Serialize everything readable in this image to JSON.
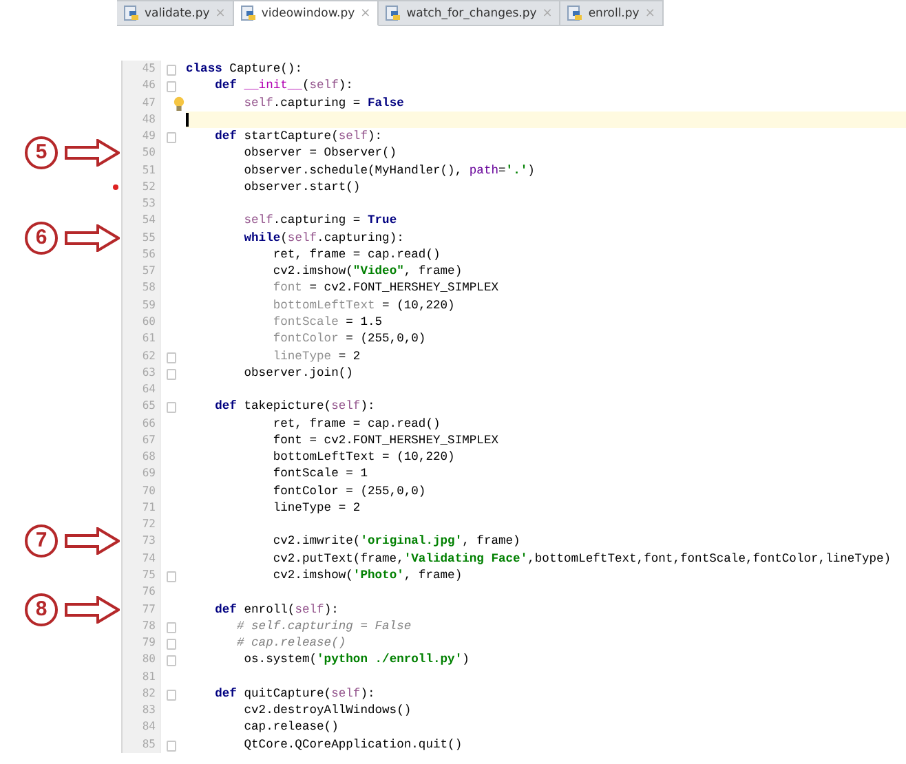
{
  "tabs": [
    {
      "label": "validate.py",
      "close": "×",
      "selected": false
    },
    {
      "label": "videowindow.py",
      "close": "×",
      "selected": true
    },
    {
      "label": "watch_for_changes.py",
      "close": "×",
      "selected": false
    },
    {
      "label": "enroll.py",
      "close": "×",
      "selected": false
    }
  ],
  "lines": [
    {
      "number": "45",
      "fold": true,
      "tokens": [
        {
          "text": "class",
          "kind": "kw"
        },
        {
          "text": " Capture():",
          "kind": "plain"
        }
      ]
    },
    {
      "number": "46",
      "fold": true,
      "tokens": [
        {
          "text": "    def ",
          "kind": "kw"
        },
        {
          "text": "__init__",
          "kind": "magic"
        },
        {
          "text": "(",
          "kind": "plain"
        },
        {
          "text": "self",
          "kind": "self"
        },
        {
          "text": "):",
          "kind": "plain"
        }
      ]
    },
    {
      "number": "47",
      "bulb": true,
      "tokens": [
        {
          "text": "        self",
          "kind": "self"
        },
        {
          "text": ".capturing = ",
          "kind": "plain"
        },
        {
          "text": "False",
          "kind": "kw"
        }
      ]
    },
    {
      "number": "48",
      "current": true
    },
    {
      "number": "49",
      "fold": true,
      "tokens": [
        {
          "text": "    def",
          "kind": "kw"
        },
        {
          "text": " startCapture(",
          "kind": "plain"
        },
        {
          "text": "self",
          "kind": "self"
        },
        {
          "text": "):",
          "kind": "plain"
        }
      ]
    },
    {
      "number": "50",
      "callout": "5",
      "tokens": [
        {
          "text": "        observer = Observer()",
          "kind": "plain"
        }
      ]
    },
    {
      "number": "51",
      "tokens": [
        {
          "text": "        observer.schedule(MyHandler(), ",
          "kind": "plain"
        },
        {
          "text": "path",
          "kind": "param"
        },
        {
          "text": "=",
          "kind": "plain"
        },
        {
          "text": "'.'",
          "kind": "str"
        },
        {
          "text": ")",
          "kind": "plain"
        }
      ]
    },
    {
      "number": "52",
      "marker": true,
      "tokens": [
        {
          "text": "        observer.start()",
          "kind": "plain"
        }
      ]
    },
    {
      "number": "53"
    },
    {
      "number": "54",
      "tokens": [
        {
          "text": "        self",
          "kind": "self"
        },
        {
          "text": ".capturing = ",
          "kind": "plain"
        },
        {
          "text": "True",
          "kind": "kw"
        }
      ]
    },
    {
      "number": "55",
      "callout": "6",
      "tokens": [
        {
          "text": "        while",
          "kind": "kw"
        },
        {
          "text": "(",
          "kind": "plain"
        },
        {
          "text": "self",
          "kind": "self"
        },
        {
          "text": ".capturing):",
          "kind": "plain"
        }
      ]
    },
    {
      "number": "56",
      "tokens": [
        {
          "text": "            ret, frame = cap.read()",
          "kind": "plain"
        }
      ]
    },
    {
      "number": "57",
      "tokens": [
        {
          "text": "            cv2.imshow(",
          "kind": "plain"
        },
        {
          "text": "\"Video\"",
          "kind": "str"
        },
        {
          "text": ", frame)",
          "kind": "plain"
        }
      ]
    },
    {
      "number": "58",
      "tokens": [
        {
          "text": "            font",
          "kind": "unused"
        },
        {
          "text": " = cv2.FONT_HERSHEY_SIMPLEX",
          "kind": "plain"
        }
      ]
    },
    {
      "number": "59",
      "tokens": [
        {
          "text": "            bottomLeftText",
          "kind": "unused"
        },
        {
          "text": " = (10,220)",
          "kind": "plain"
        }
      ]
    },
    {
      "number": "60",
      "tokens": [
        {
          "text": "            fontScale",
          "kind": "unused"
        },
        {
          "text": " = 1.5",
          "kind": "plain"
        }
      ]
    },
    {
      "number": "61",
      "tokens": [
        {
          "text": "            fontColor",
          "kind": "unused"
        },
        {
          "text": " = (255,0,0)",
          "kind": "plain"
        }
      ]
    },
    {
      "number": "62",
      "fold": true,
      "tokens": [
        {
          "text": "            lineType",
          "kind": "unused"
        },
        {
          "text": " = 2",
          "kind": "plain"
        }
      ]
    },
    {
      "number": "63",
      "fold": true,
      "tokens": [
        {
          "text": "        observer.join()",
          "kind": "plain"
        }
      ]
    },
    {
      "number": "64"
    },
    {
      "number": "65",
      "fold": true,
      "tokens": [
        {
          "text": "    def",
          "kind": "kw"
        },
        {
          "text": " takepicture(",
          "kind": "plain"
        },
        {
          "text": "self",
          "kind": "self"
        },
        {
          "text": "):",
          "kind": "plain"
        }
      ]
    },
    {
      "number": "66",
      "tokens": [
        {
          "text": "            ret, frame = cap.read()",
          "kind": "plain"
        }
      ]
    },
    {
      "number": "67",
      "tokens": [
        {
          "text": "            font = cv2.FONT_HERSHEY_SIMPLEX",
          "kind": "plain"
        }
      ]
    },
    {
      "number": "68",
      "tokens": [
        {
          "text": "            bottomLeftText = (10,220)",
          "kind": "plain"
        }
      ]
    },
    {
      "number": "69",
      "tokens": [
        {
          "text": "            fontScale = 1",
          "kind": "plain"
        }
      ]
    },
    {
      "number": "70",
      "tokens": [
        {
          "text": "            fontColor = (255,0,0)",
          "kind": "plain"
        }
      ]
    },
    {
      "number": "71",
      "tokens": [
        {
          "text": "            lineType = 2",
          "kind": "plain"
        }
      ]
    },
    {
      "number": "72"
    },
    {
      "number": "73",
      "callout": "7",
      "tokens": [
        {
          "text": "            cv2.imwrite(",
          "kind": "plain"
        },
        {
          "text": "'original.jpg'",
          "kind": "str"
        },
        {
          "text": ", frame)",
          "kind": "plain"
        }
      ]
    },
    {
      "number": "74",
      "tokens": [
        {
          "text": "            cv2.putText(frame,",
          "kind": "plain"
        },
        {
          "text": "'Validating Face'",
          "kind": "str"
        },
        {
          "text": ",bottomLeftText,font,fontScale,fontColor,lineType)",
          "kind": "plain"
        }
      ]
    },
    {
      "number": "75",
      "fold": true,
      "tokens": [
        {
          "text": "            cv2.imshow(",
          "kind": "plain"
        },
        {
          "text": "'Photo'",
          "kind": "str"
        },
        {
          "text": ", frame)",
          "kind": "plain"
        }
      ]
    },
    {
      "number": "76"
    },
    {
      "number": "77",
      "callout": "8",
      "tokens": [
        {
          "text": "    def",
          "kind": "kw"
        },
        {
          "text": " enroll(",
          "kind": "plain"
        },
        {
          "text": "self",
          "kind": "self"
        },
        {
          "text": "):",
          "kind": "plain"
        }
      ]
    },
    {
      "number": "78",
      "fold": true,
      "tokens": [
        {
          "text": "       # self.capturing = False",
          "kind": "comment"
        }
      ]
    },
    {
      "number": "79",
      "fold": true,
      "tokens": [
        {
          "text": "       # cap.release()",
          "kind": "comment"
        }
      ]
    },
    {
      "number": "80",
      "fold": true,
      "tokens": [
        {
          "text": "        os.system(",
          "kind": "plain"
        },
        {
          "text": "'python ./enroll.py'",
          "kind": "str"
        },
        {
          "text": ")",
          "kind": "plain"
        }
      ]
    },
    {
      "number": "81"
    },
    {
      "number": "82",
      "fold": true,
      "tokens": [
        {
          "text": "    def",
          "kind": "kw"
        },
        {
          "text": " quitCapture(",
          "kind": "plain"
        },
        {
          "text": "self",
          "kind": "self"
        },
        {
          "text": "):",
          "kind": "plain"
        }
      ]
    },
    {
      "number": "83",
      "tokens": [
        {
          "text": "        cv2.destroyAllWindows()",
          "kind": "plain"
        }
      ]
    },
    {
      "number": "84",
      "tokens": [
        {
          "text": "        cap.release()",
          "kind": "plain"
        }
      ]
    },
    {
      "number": "85",
      "fold": true,
      "tokens": [
        {
          "text": "        QtCore.QCoreApplication.quit()",
          "kind": "plain"
        }
      ]
    }
  ]
}
